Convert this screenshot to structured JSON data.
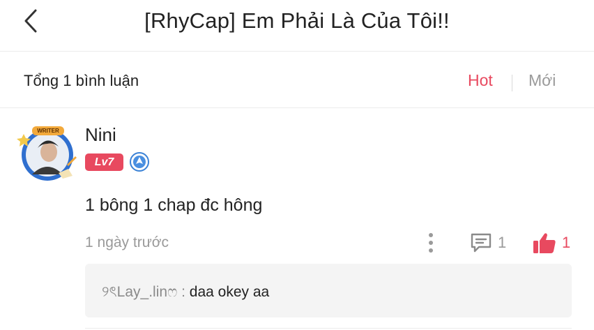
{
  "header": {
    "title": "[RhyCap] Em Phải Là Của Tôi!!",
    "back_icon": "chevron-left-icon"
  },
  "subbar": {
    "comment_count": "Tổng 1 bình luận",
    "sort_hot": "Hot",
    "sort_new": "Mới",
    "active_sort": "Hot"
  },
  "comment": {
    "username": "Nini",
    "level": "Lv7",
    "avatar_badge_text": "WRITER",
    "text": "1 bông 1 chap đc hông",
    "timestamp": "1 ngày trước",
    "reply_count": "1",
    "like_count": "1",
    "reply": {
      "author": "୨ৎLay_.linෆ",
      "separator": " : ",
      "text": "daa okey aa"
    }
  },
  "colors": {
    "accent": "#e8495f",
    "muted": "#9a9a9a",
    "text": "#222222",
    "reply_bg": "#f4f4f4"
  }
}
